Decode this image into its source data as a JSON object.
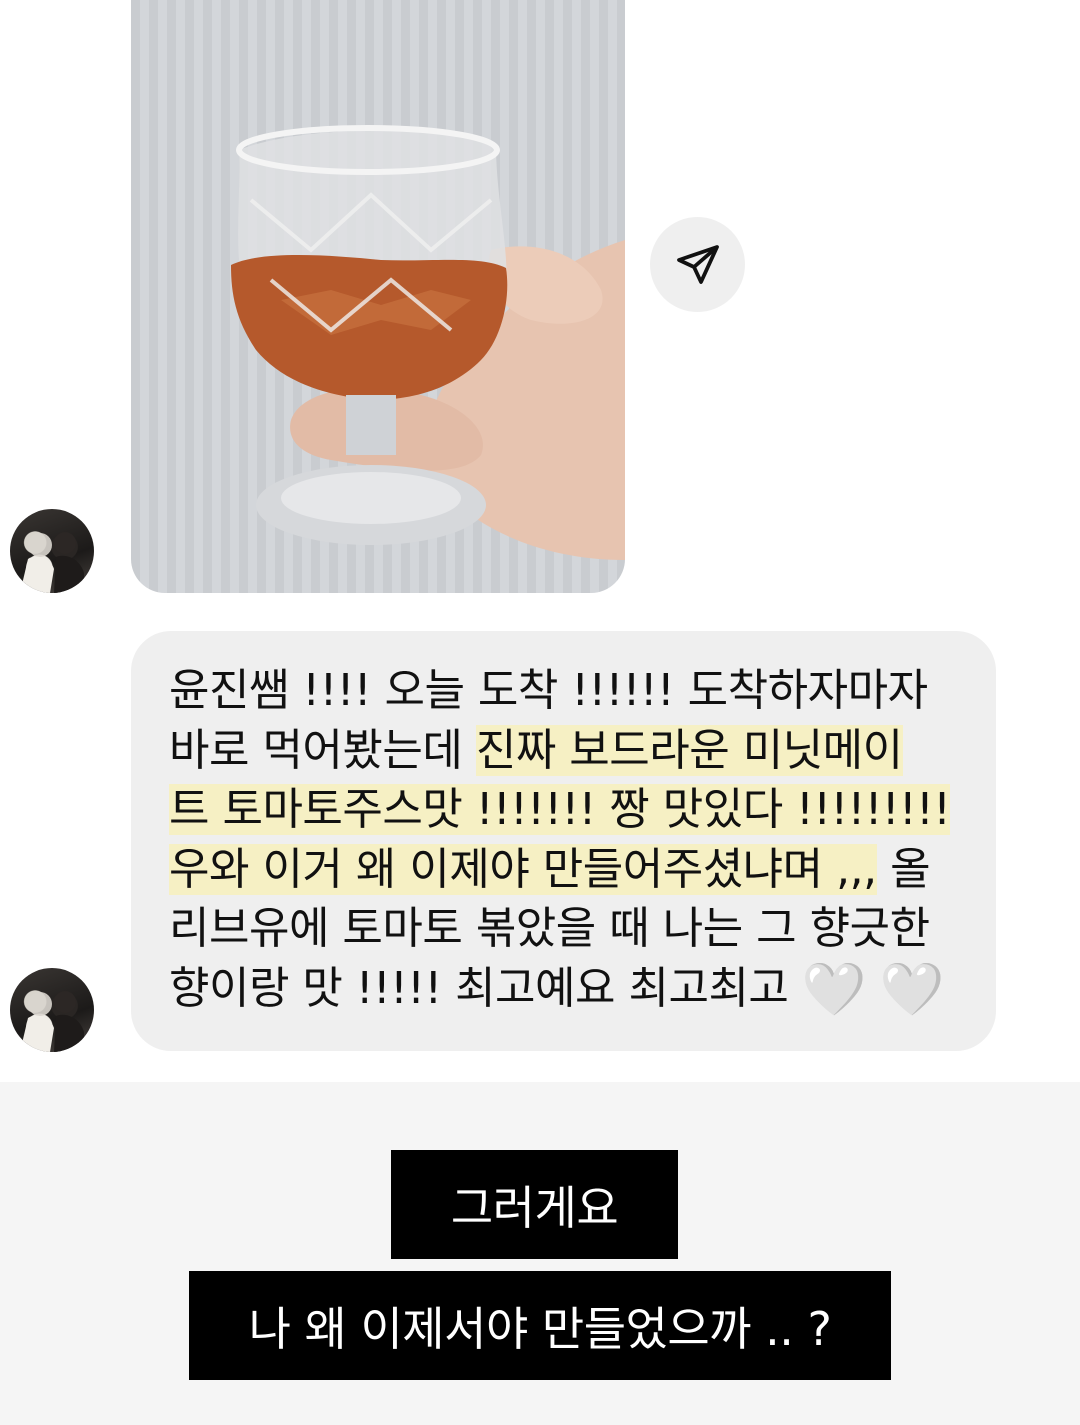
{
  "photo_message": {
    "image_alt": "hand holding crystal glass of tomato juice"
  },
  "share_button": {
    "icon": "send-icon"
  },
  "reply_message": {
    "lines": [
      {
        "segments": [
          {
            "text": "윤진쌤 !!!! 오늘 도착 !!!!!! 도착하자마자",
            "highlight": false
          }
        ]
      },
      {
        "segments": [
          {
            "text": "바로 먹어봤는데 ",
            "highlight": false
          },
          {
            "text": "진짜 보드라운 미닛메이",
            "highlight": true
          }
        ]
      },
      {
        "segments": [
          {
            "text": "트 토마토주스맛 !!!!!!! 짱 맛있다 !!!!!!!!!",
            "highlight": true
          }
        ]
      },
      {
        "segments": [
          {
            "text": "우와 이거 왜 이제야 만들어주셨냐며 ,,,",
            "highlight": true
          },
          {
            "text": " 올",
            "highlight": false
          }
        ]
      },
      {
        "segments": [
          {
            "text": "리브유에 토마토 볶았을 때 나는 그 향긋한",
            "highlight": false
          }
        ]
      },
      {
        "segments": [
          {
            "text": "향이랑 맛 !!!!! 최고예요 최고최고 ",
            "highlight": false
          }
        ]
      }
    ],
    "emoji": [
      "🤍",
      "🤍"
    ]
  },
  "captions": {
    "line1": "그러게요",
    "line2": "나 왜 이제서야 만들었으까 .. ?"
  },
  "colors": {
    "bubble": "#efefef",
    "highlight": "#f6f0c4",
    "caption_bg": "#000000",
    "caption_text": "#ffffff",
    "caption_area": "#f5f5f5"
  }
}
